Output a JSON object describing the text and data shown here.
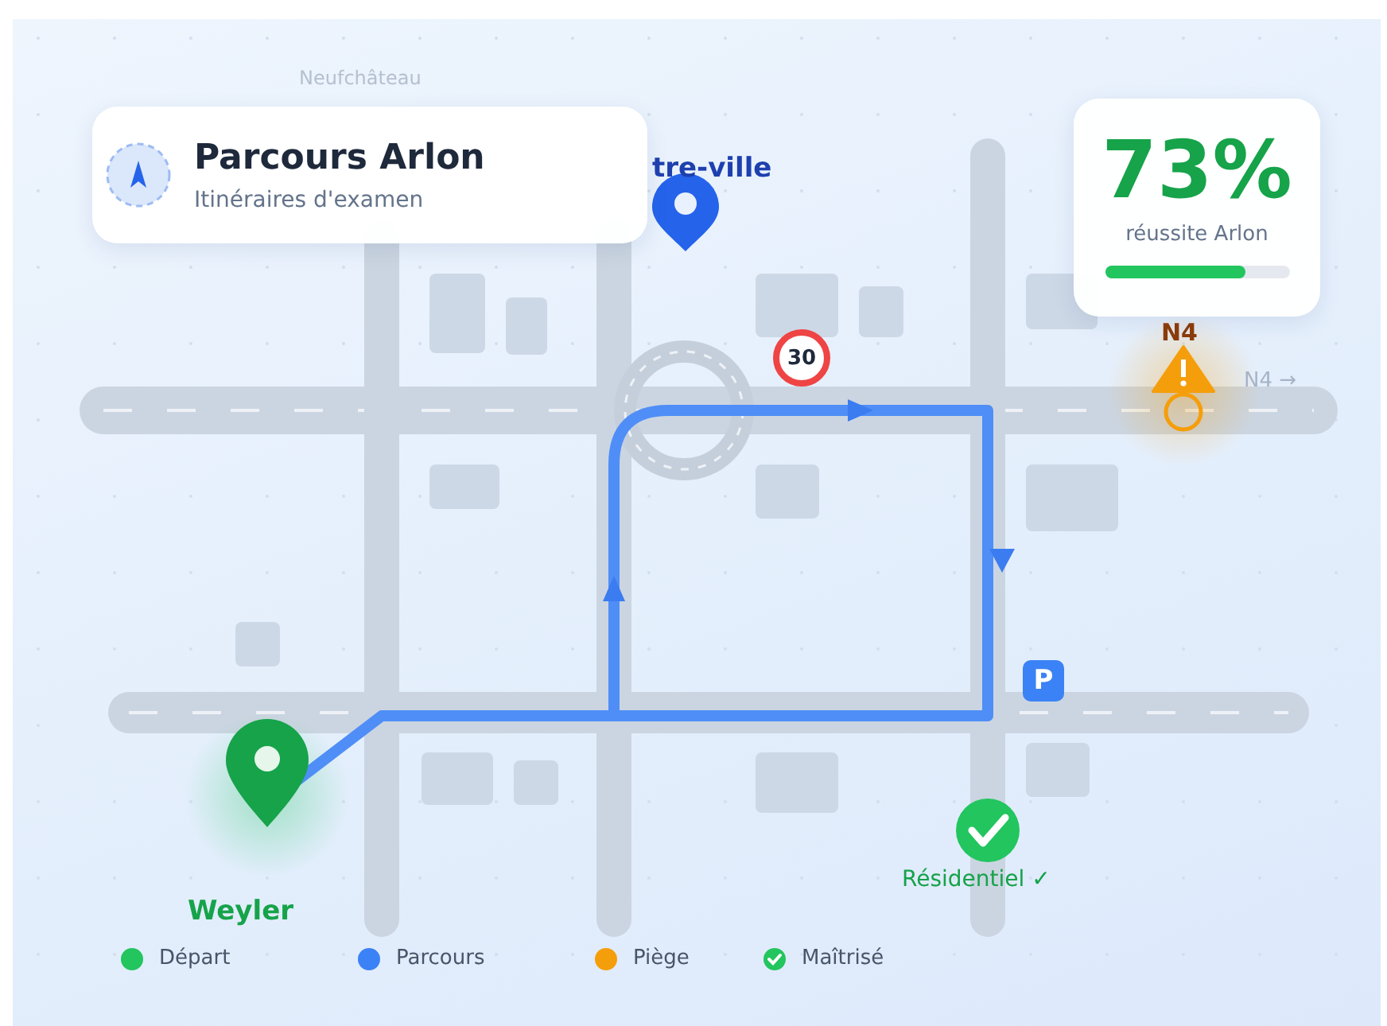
{
  "header": {
    "title": "Parcours Arlon",
    "subtitle": "Itinéraires d'examen"
  },
  "stats": {
    "value": "73%",
    "label": "réussite Arlon",
    "level": 0.76
  },
  "map": {
    "labels": [
      {
        "kind": "town",
        "text": "Neufchâteau"
      },
      {
        "kind": "district",
        "text": "tre-ville"
      },
      {
        "kind": "road",
        "text": "N4 →"
      }
    ],
    "speed_limit": "30",
    "hazard": {
      "label": "N4"
    },
    "parking": "P",
    "start": {
      "label": "Weyler"
    },
    "mastered": {
      "label": "Résidentiel ✓"
    }
  },
  "legend": [
    {
      "kind": "dot",
      "label": "Départ",
      "color": "#22c55e"
    },
    {
      "kind": "dot",
      "label": "Parcours",
      "color": "#3b82f6"
    },
    {
      "kind": "dot",
      "label": "Piège",
      "color": "#f59e0b"
    },
    {
      "kind": "check",
      "label": "Maîtrisé",
      "color": "#22c55e"
    }
  ]
}
